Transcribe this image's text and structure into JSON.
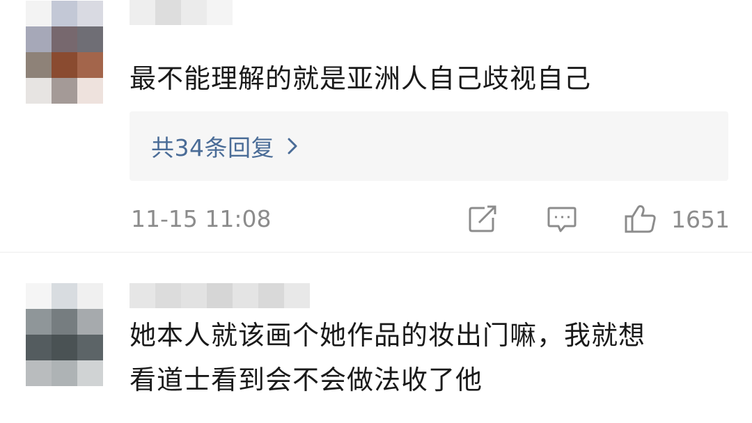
{
  "comments": [
    {
      "text": "最不能理解的就是亚洲人自己歧视自己",
      "replies_label": "共34条回复",
      "timestamp": "11-15 11:08",
      "like_count": "1651",
      "icons": {
        "share": "share-icon",
        "reply": "comment-icon",
        "like": "thumbs-up-icon",
        "replies": "chevron-right-icon"
      }
    },
    {
      "text_lines": [
        "她本人就该画个她作品的妆出门嘛，我就想",
        "看道士看到会不会做法收了他"
      ]
    }
  ],
  "colors": {
    "text": "#1a1a1a",
    "meta": "#8c8c8c",
    "link": "#4a6c97",
    "replies_bg": "#f6f6f6"
  }
}
